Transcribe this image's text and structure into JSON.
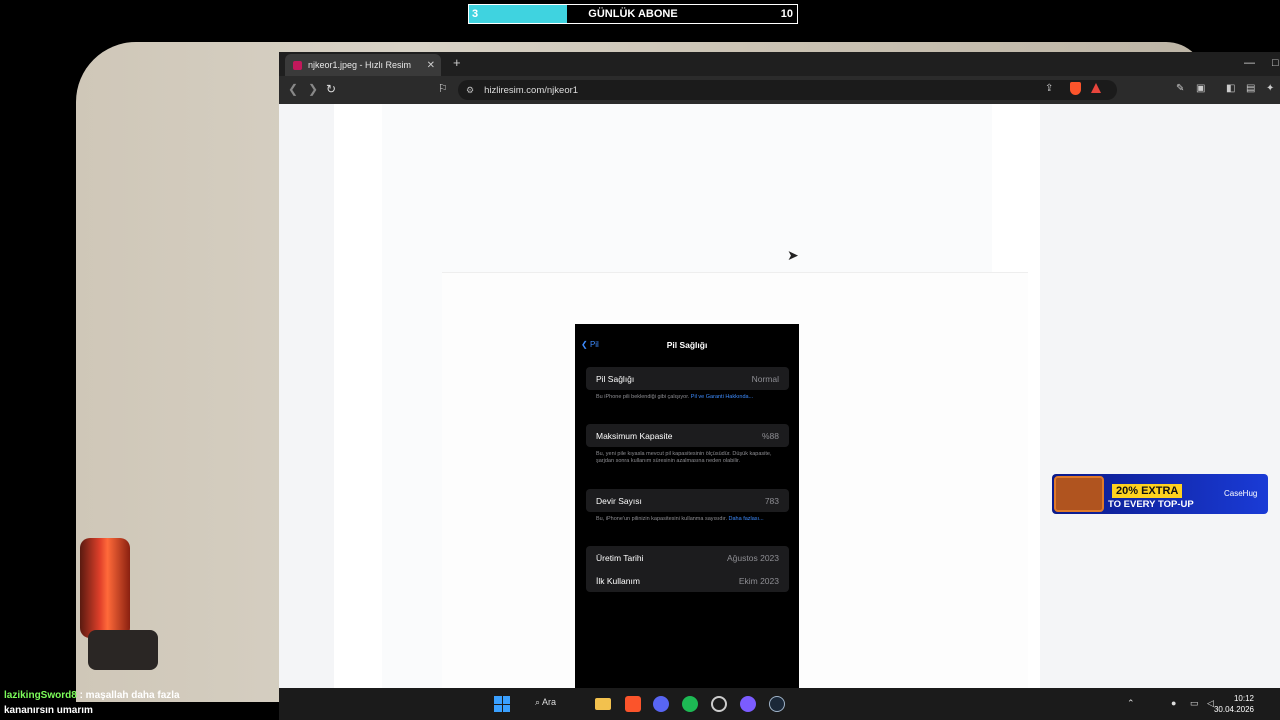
{
  "overlay": {
    "sub_current": "3",
    "sub_title": "GÜNLÜK ABONE",
    "sub_goal": "10",
    "sub_progress": 0.3
  },
  "tab": {
    "title": "njkeor1.jpeg - Hızlı Resim",
    "close": "✕",
    "new": "+"
  },
  "window": {
    "minimize": "—"
  },
  "address": {
    "url": "hizliresim.com/njkeor1"
  },
  "phone": {
    "back": "Pil",
    "title": "Pil Sağlığı",
    "health_label": "Pil Sağlığı",
    "health_value": "Normal",
    "health_note": "Bu iPhone pili beklendiği gibi çalışıyor.",
    "health_link": "Pil ve Garanti Hakkında...",
    "capacity_label": "Maksimum Kapasite",
    "capacity_value": "%88",
    "capacity_note": "Bu, yeni pile kıyasla mevcut pil kapasitesinin ölçüsüdür. Düşük kapasite, şarjdan sonra kullanım süresinin azalmasına neden olabilir.",
    "cycle_label": "Devir Sayısı",
    "cycle_value": "783",
    "cycle_note": "Bu, iPhone'un pilinizin kapasitesini kullanma sayısıdır.",
    "cycle_link": "Daha fazlası...",
    "mfg_label": "Üretim Tarihi",
    "mfg_value": "Ağustos 2023",
    "first_use_label": "İlk Kullanım",
    "first_use_value": "Ekim 2023"
  },
  "ad": {
    "percent": "20% EXTRA",
    "subtitle": "TO EVERY TOP-UP",
    "brand": "CaseHug"
  },
  "chat": {
    "user": "lazikingSword8",
    "message_line1": " : maşallah daha fazla",
    "message_line2": "kananırsın umarım"
  },
  "taskbar": {
    "search_label": "Ara",
    "time": "10:12",
    "date": "30.04.2026"
  },
  "colors": {
    "accent": "#3d8bfd",
    "sub_fill": "#3fd3e0",
    "brand_red": "#fb542b"
  }
}
